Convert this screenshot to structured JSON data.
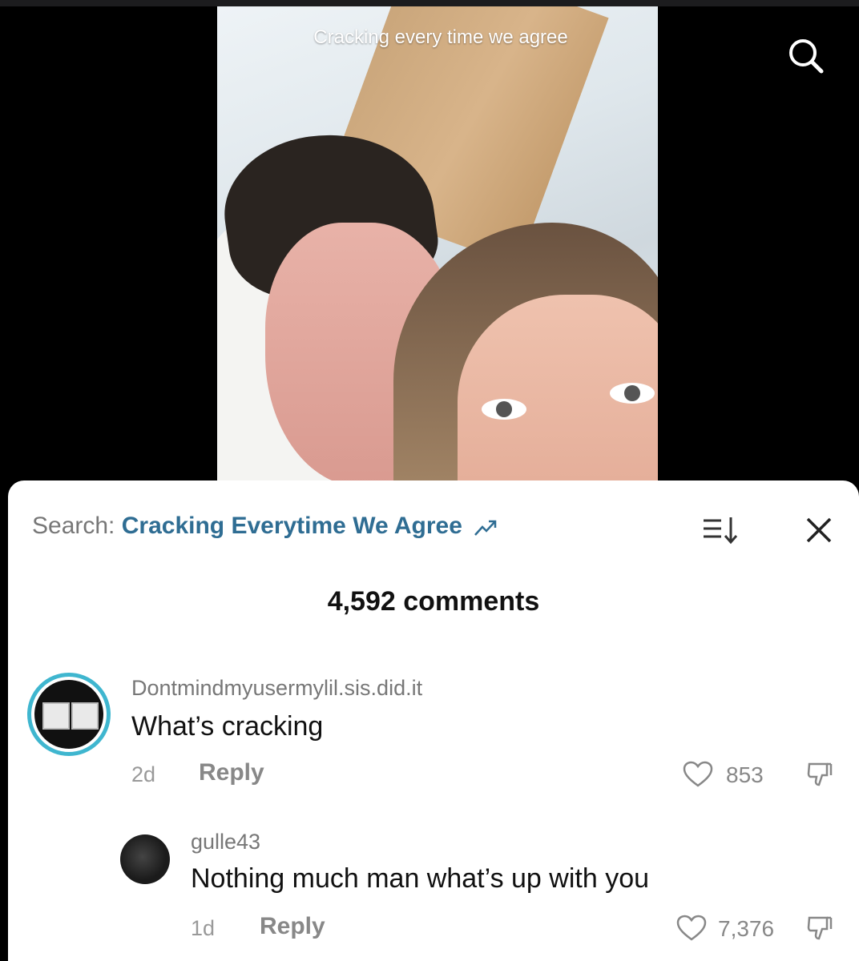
{
  "video": {
    "caption": "Cracking every time we agree"
  },
  "header": {
    "search_prefix": "Search:",
    "search_term": "Cracking Everytime We Agree",
    "comment_count": "4,592 comments"
  },
  "comments": [
    {
      "username": "Dontmindmyusermylil.sis.did.it",
      "text": "What’s cracking",
      "age": "2d",
      "reply_label": "Reply",
      "likes": "853"
    },
    {
      "username": "gulle43",
      "text": "Nothing much man what’s up with you",
      "age": "1d",
      "reply_label": "Reply",
      "likes": "7,376"
    }
  ],
  "colors": {
    "accent": "#2f6d93",
    "avatar_ring": "#3fb6cf"
  },
  "icons": [
    "search-icon",
    "trending-icon",
    "sort-icon",
    "close-icon",
    "heart-icon",
    "dislike-icon"
  ]
}
